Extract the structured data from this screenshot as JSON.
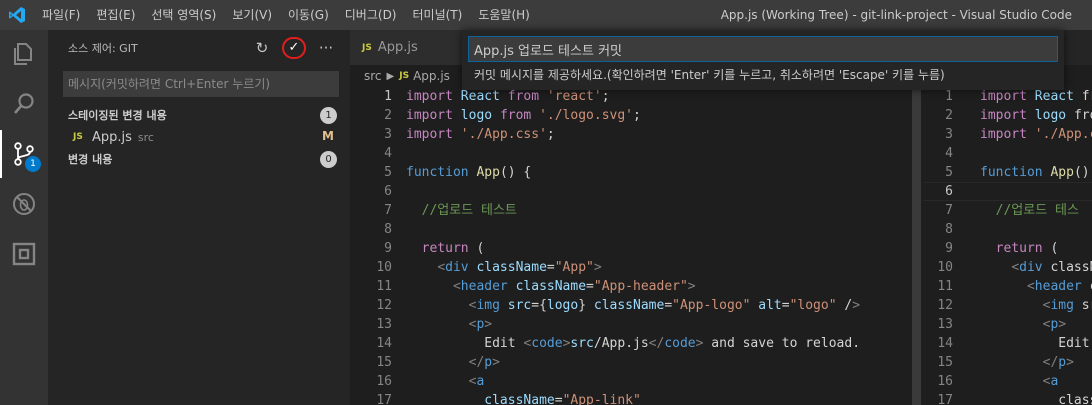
{
  "menu": {
    "items": [
      "파일(F)",
      "편집(E)",
      "선택 영역(S)",
      "보기(V)",
      "이동(G)",
      "디버그(D)",
      "터미널(T)",
      "도움말(H)"
    ]
  },
  "window_title": "App.js (Working Tree) - git-link-project - Visual Studio Code",
  "activity": {
    "scm_badge": "1"
  },
  "sidebar": {
    "title": "소스 제어: GIT",
    "refresh_icon": "↻",
    "commit_icon": "✓",
    "more_icon": "···",
    "message_placeholder": "메시지(커밋하려면 Ctrl+Enter 누르기)",
    "staged_label": "스테이징된 변경 내용",
    "staged_count": "1",
    "changes_label": "변경 내용",
    "changes_count": "0",
    "file": {
      "badge": "JS",
      "name": "App.js",
      "dir": "src",
      "status": "M"
    }
  },
  "tab": {
    "badge": "JS",
    "label": "App.js"
  },
  "breadcrumbs": {
    "folder": "src",
    "badge": "JS",
    "file": "App.js"
  },
  "quick_input": {
    "value": "App.js 업로드 테스트 커밋",
    "message": "커밋 메시지를 제공하세요.(확인하려면 'Enter' 키를 누르고, 취소하려면 'Escape' 키를 누름)"
  },
  "editor_left": {
    "line_numbers": [
      "1",
      "2",
      "3",
      "4",
      "5",
      "6",
      "7",
      "8",
      "9",
      "10",
      "11",
      "12",
      "13",
      "14",
      "15",
      "16",
      "17"
    ],
    "lines": [
      "import React from 'react';",
      "import logo from './logo.svg';",
      "import './App.css';",
      "",
      "function App() {",
      "",
      "  //업로드 테스트",
      "",
      "  return (",
      "    <div className=\"App\">",
      "      <header className=\"App-header\">",
      "        <img src={logo} className=\"App-logo\" alt=\"logo\" />",
      "        <p>",
      "          Edit <code>src/App.js</code> and save to reload.",
      "        </p>",
      "        <a",
      "          className=\"App-link\""
    ]
  },
  "editor_right": {
    "line_numbers": [
      "1",
      "2",
      "3",
      "4",
      "5",
      "6",
      "7",
      "8",
      "9",
      "10",
      "11",
      "12",
      "13",
      "14",
      "15",
      "16",
      "17"
    ],
    "lines": [
      "import React fr",
      "import logo fro",
      "import './App.c",
      "",
      "function App() ",
      "",
      "  //업로드 테스",
      "",
      "  return (",
      "    <div classN",
      "      <header c",
      "        <img sr",
      "        <p>",
      "          Edit",
      "        </p>",
      "        <a",
      "          class"
    ]
  }
}
